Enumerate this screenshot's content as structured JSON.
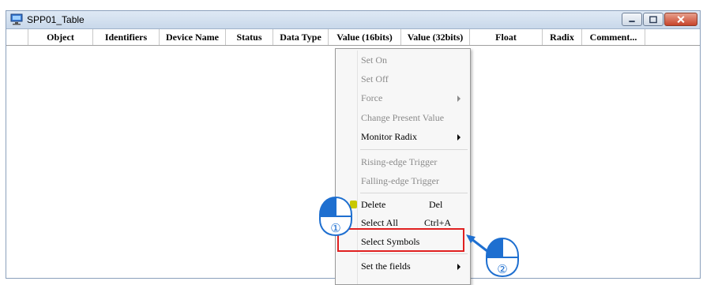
{
  "window": {
    "title": "SPP01_Table",
    "buttons": [
      "minimize",
      "maximize",
      "close"
    ]
  },
  "table": {
    "columns": [
      "Object",
      "Identifiers",
      "Device Name",
      "Status",
      "Data Type",
      "Value (16bits)",
      "Value (32bits)",
      "Float",
      "Radix",
      "Comment..."
    ]
  },
  "context_menu": {
    "items": [
      {
        "label": "Set On",
        "enabled": false
      },
      {
        "label": "Set Off",
        "enabled": false
      },
      {
        "label": "Force",
        "enabled": false,
        "submenu": true
      },
      {
        "label": "Change Present Value",
        "enabled": false
      },
      {
        "label": "Monitor Radix",
        "enabled": true,
        "submenu": true
      },
      {
        "label": "Rising-edge Trigger",
        "enabled": false
      },
      {
        "label": "Falling-edge Trigger",
        "enabled": false
      },
      {
        "label": "Delete",
        "shortcut": "Del",
        "enabled": true
      },
      {
        "label": "Select All",
        "shortcut": "Ctrl+A",
        "enabled": true
      },
      {
        "label": "Select Symbols",
        "enabled": true,
        "highlighted": true
      },
      {
        "label": "Set the fields",
        "enabled": true,
        "submenu": true
      }
    ]
  },
  "callouts": {
    "step1": "①",
    "step2": "②"
  },
  "colors": {
    "highlight": "#e02020",
    "callout_blue": "#1e6fd0"
  }
}
